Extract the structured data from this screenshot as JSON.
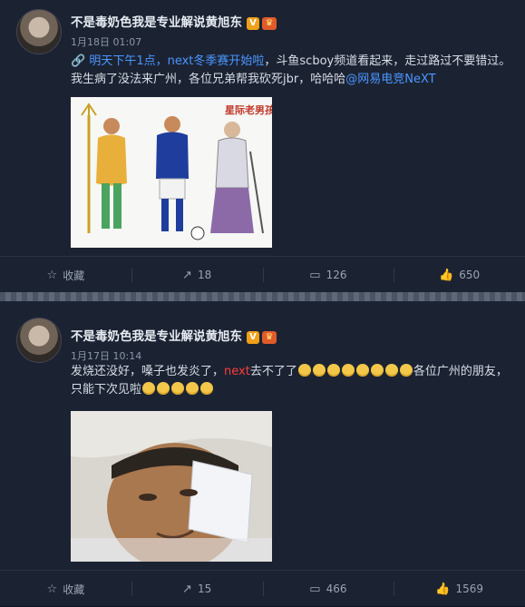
{
  "posts": [
    {
      "author": "不是毒奶色我是专业解说黄旭东",
      "badge_v": "V",
      "time": "1月18日 01:07",
      "text_link": "明天下午1点，next冬季赛开始啦",
      "text_body": "，斗鱼scboy频道看起来，走过路过不要错过。我生病了没法来广州，各位兄弟帮我砍死jbr，哈哈哈",
      "text_mention": "@网易电竞NeXT",
      "image_caption": "星际老男孩",
      "actions": {
        "favorite_label": "收藏",
        "repost_count": "18",
        "comment_count": "126",
        "like_count": "650"
      }
    },
    {
      "author": "不是毒奶色我是专业解说黄旭东",
      "badge_v": "V",
      "time": "1月17日 10:14",
      "text_a": "发烧还没好，嗓子也发炎了，",
      "text_red": "next",
      "text_b": "去不了了",
      "text_c": "各位广州的朋友，只能下次见啦",
      "actions": {
        "favorite_label": "收藏",
        "repost_count": "15",
        "comment_count": "466",
        "like_count": "1569"
      }
    }
  ],
  "icons": {
    "favorite": "star-icon",
    "repost": "repost-icon",
    "comment": "comment-icon",
    "like": "thumbs-up-icon",
    "link": "link-icon"
  },
  "colors": {
    "background": "#1b2333",
    "link": "#4c96ff",
    "highlight": "#ff3b3b",
    "verified": "#f0a019"
  }
}
